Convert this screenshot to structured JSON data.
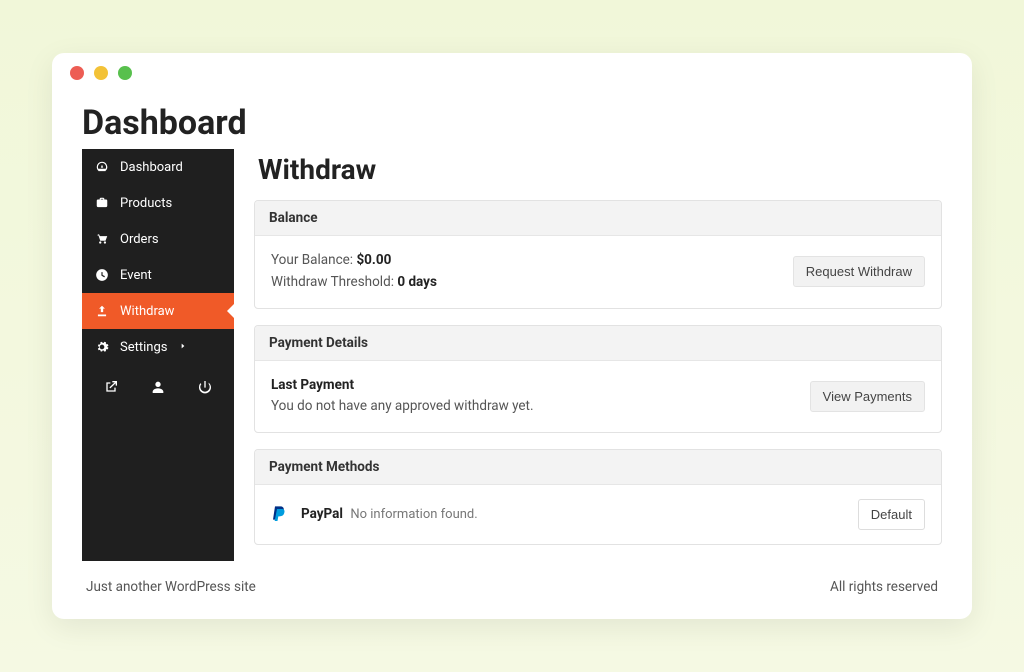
{
  "page_title": "Dashboard",
  "main_title": "Withdraw",
  "sidebar": {
    "items": [
      {
        "label": "Dashboard",
        "icon": "gauge"
      },
      {
        "label": "Products",
        "icon": "briefcase"
      },
      {
        "label": "Orders",
        "icon": "cart"
      },
      {
        "label": "Event",
        "icon": "clock"
      },
      {
        "label": "Withdraw",
        "icon": "upload",
        "active": true
      },
      {
        "label": "Settings",
        "icon": "gear",
        "chevron": true
      }
    ],
    "bottom_icons": [
      "external-link",
      "user",
      "power"
    ]
  },
  "balance": {
    "header": "Balance",
    "your_balance_label": "Your Balance:",
    "your_balance_value": "$0.00",
    "threshold_label": "Withdraw Threshold:",
    "threshold_value": "0 days",
    "button": "Request Withdraw"
  },
  "payment_details": {
    "header": "Payment Details",
    "last_payment_label": "Last Payment",
    "empty_text": "You do not have any approved withdraw yet.",
    "button": "View Payments"
  },
  "payment_methods": {
    "header": "Payment Methods",
    "method_name": "PayPal",
    "method_info": "No information found.",
    "default_button": "Default"
  },
  "footer": {
    "left": "Just another WordPress site",
    "right": "All rights reserved"
  }
}
